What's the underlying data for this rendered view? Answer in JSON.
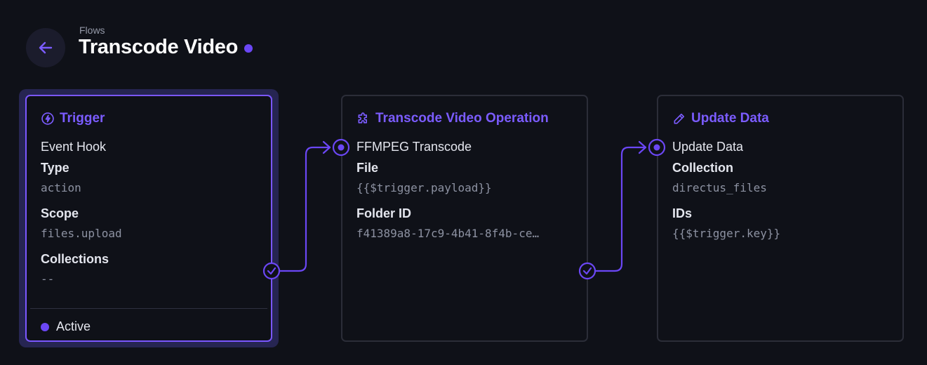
{
  "header": {
    "breadcrumb": "Flows",
    "title": "Transcode Video"
  },
  "accent_color": "#6b47f5",
  "trigger": {
    "title": "Trigger",
    "icon": "bolt-icon",
    "subtitle": "Event Hook",
    "fields": [
      {
        "label": "Type",
        "value": "action"
      },
      {
        "label": "Scope",
        "value": "files.upload"
      },
      {
        "label": "Collections",
        "value": "--"
      }
    ],
    "status": "Active"
  },
  "operations": [
    {
      "title": "Transcode Video Operation",
      "icon": "puzzle-icon",
      "subtitle": "FFMPEG Transcode",
      "fields": [
        {
          "label": "File",
          "value": "{{$trigger.payload}}"
        },
        {
          "label": "Folder ID",
          "value": "f41389a8-17c9-4b41-8f4b-ce…"
        }
      ]
    },
    {
      "title": "Update Data",
      "icon": "pencil-icon",
      "subtitle": "Update Data",
      "fields": [
        {
          "label": "Collection",
          "value": "directus_files"
        },
        {
          "label": "IDs",
          "value": "{{$trigger.key}}"
        }
      ]
    }
  ]
}
